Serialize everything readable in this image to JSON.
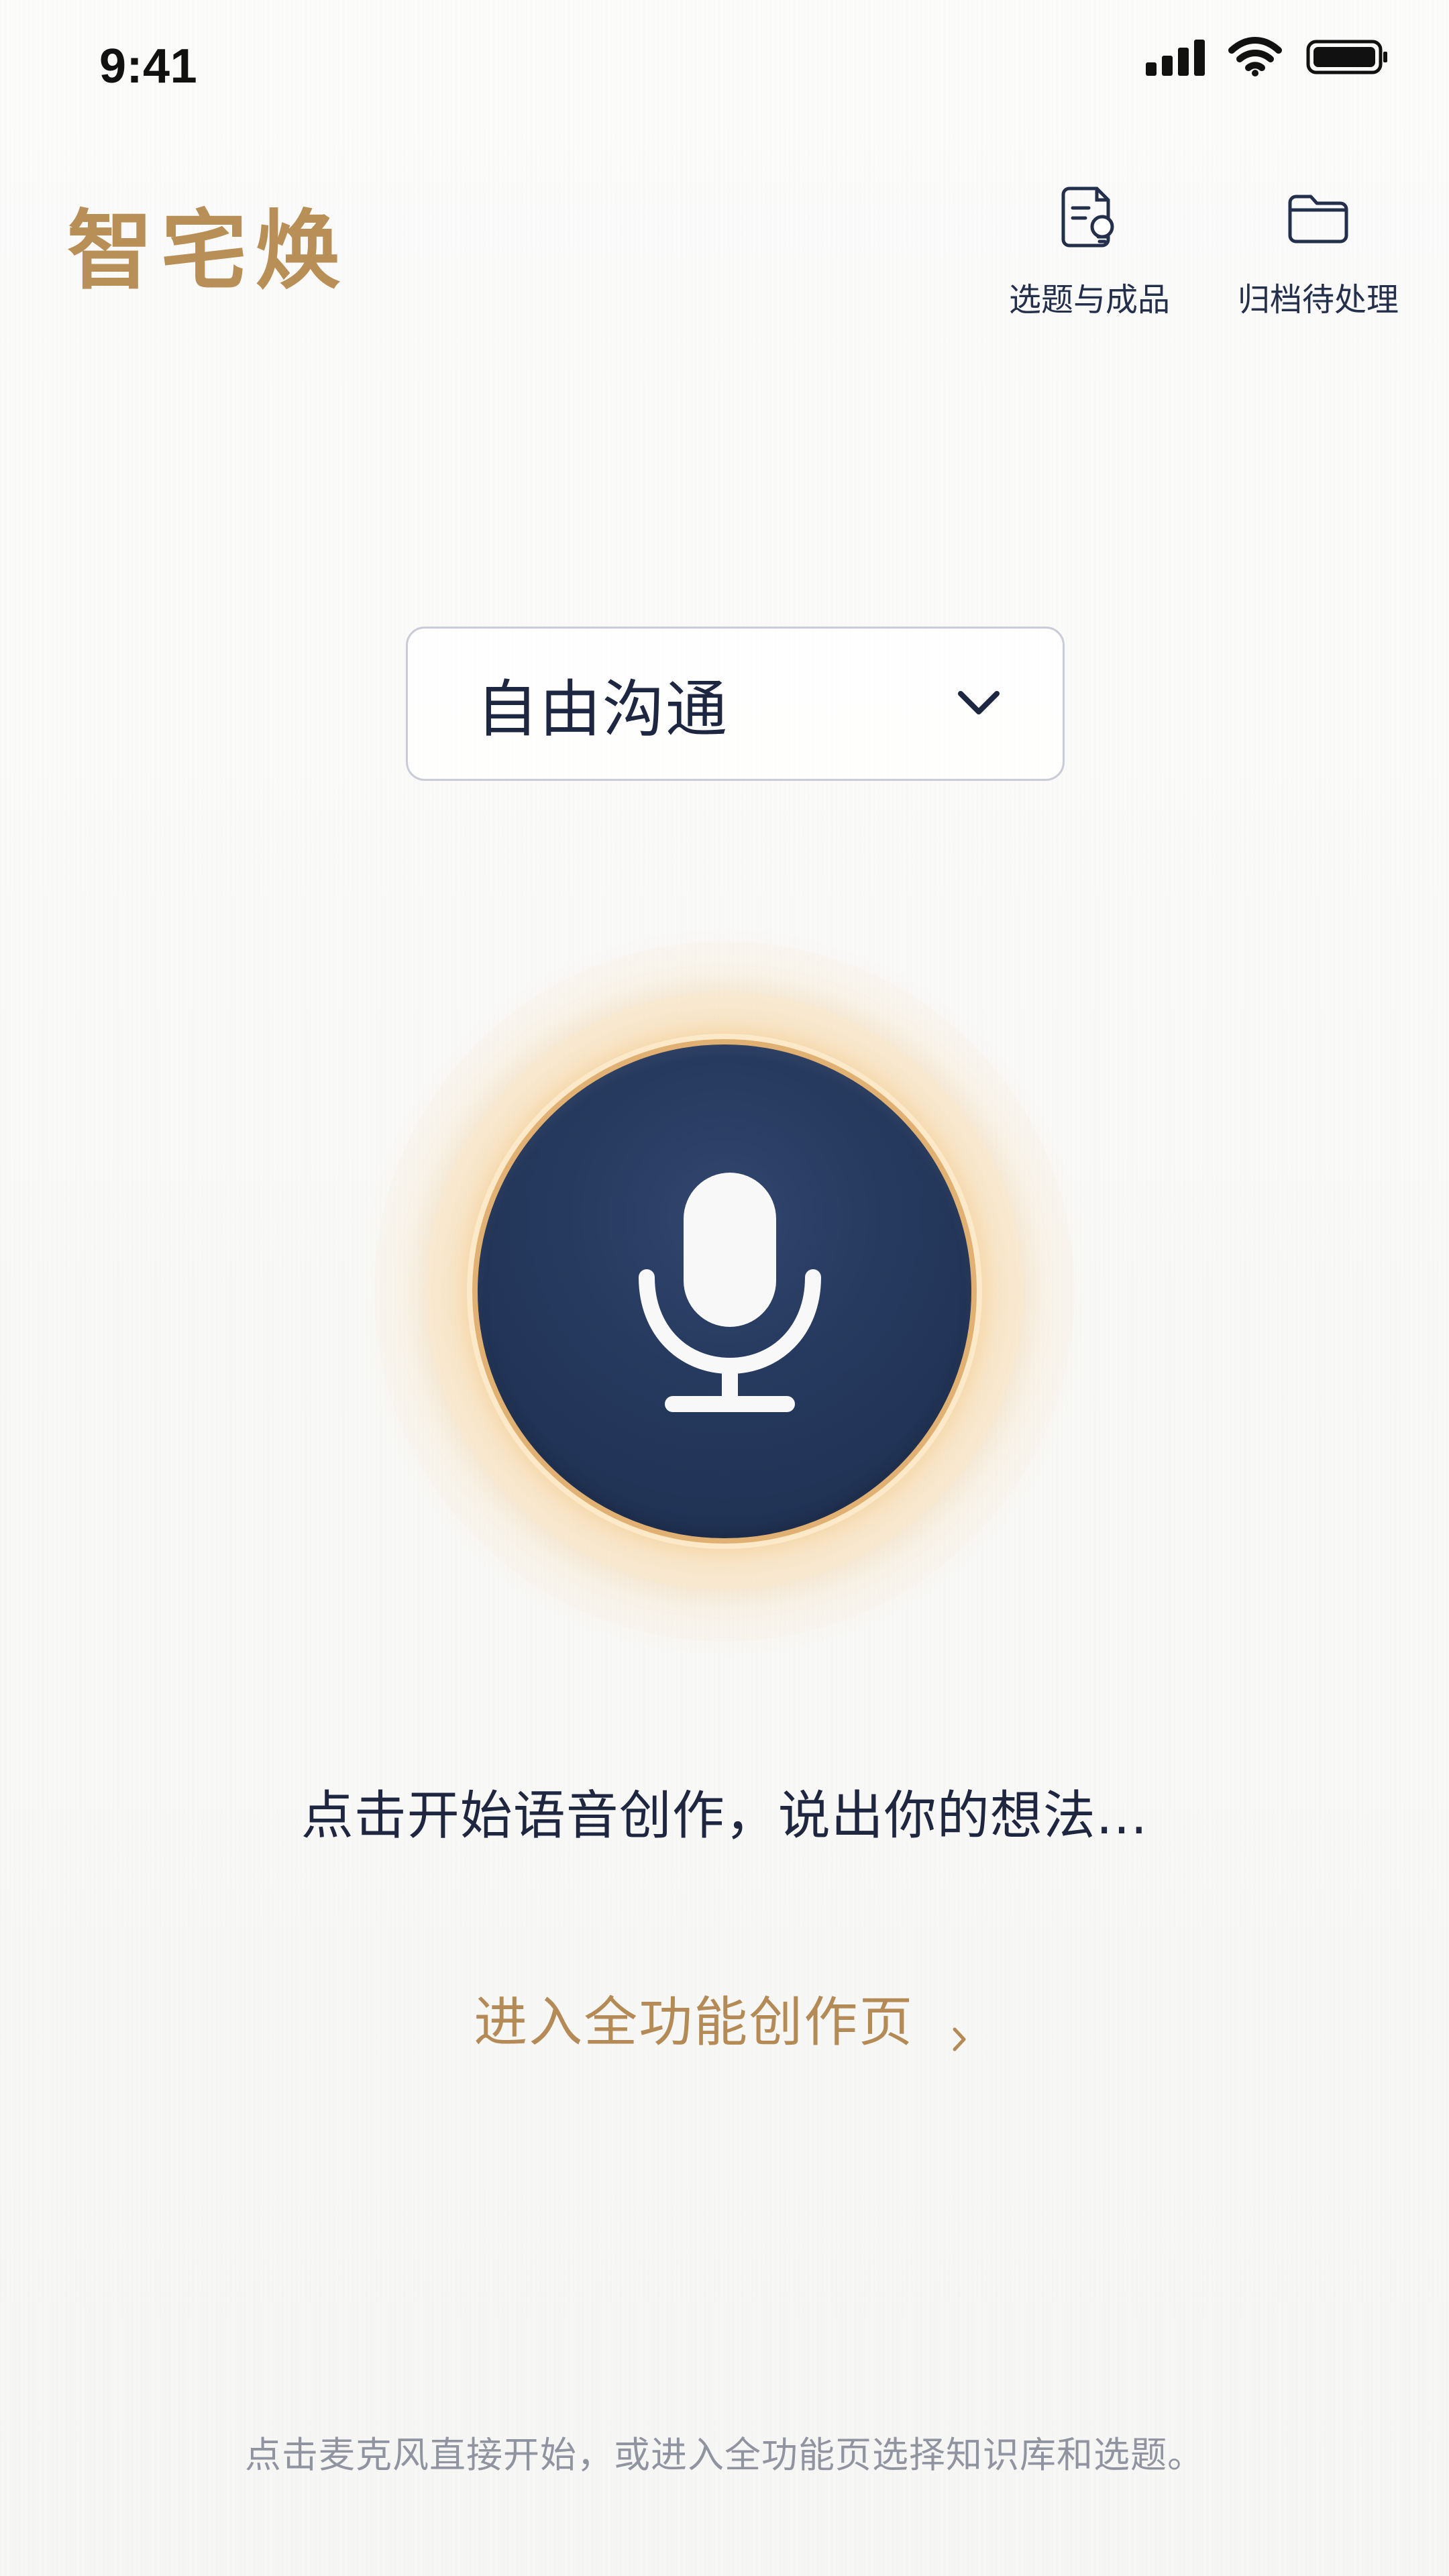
{
  "status_bar": {
    "time": "9:41",
    "icons": [
      "signal-icon",
      "wifi-icon",
      "battery-icon"
    ]
  },
  "header": {
    "brand": "智宅焕",
    "actions": [
      {
        "label": "选题与成品",
        "icon": "document-lightbulb-icon"
      },
      {
        "label": "归档待处理",
        "icon": "folder-icon"
      }
    ]
  },
  "mode_selector": {
    "value": "自由沟通",
    "icon": "chevron-down-icon"
  },
  "mic": {
    "icon": "microphone-icon"
  },
  "prompt": "点击开始语音创作，说出你的想法...",
  "full_page_link": "进入全功能创作页",
  "bottom_hint": "点击麦克风直接开始，或进入全功能页选择知识库和选题。",
  "colors": {
    "brand_gold": "#b98f58",
    "navy": "#263a5f",
    "glow": "#f2c580",
    "muted_text": "#8f94a0"
  }
}
